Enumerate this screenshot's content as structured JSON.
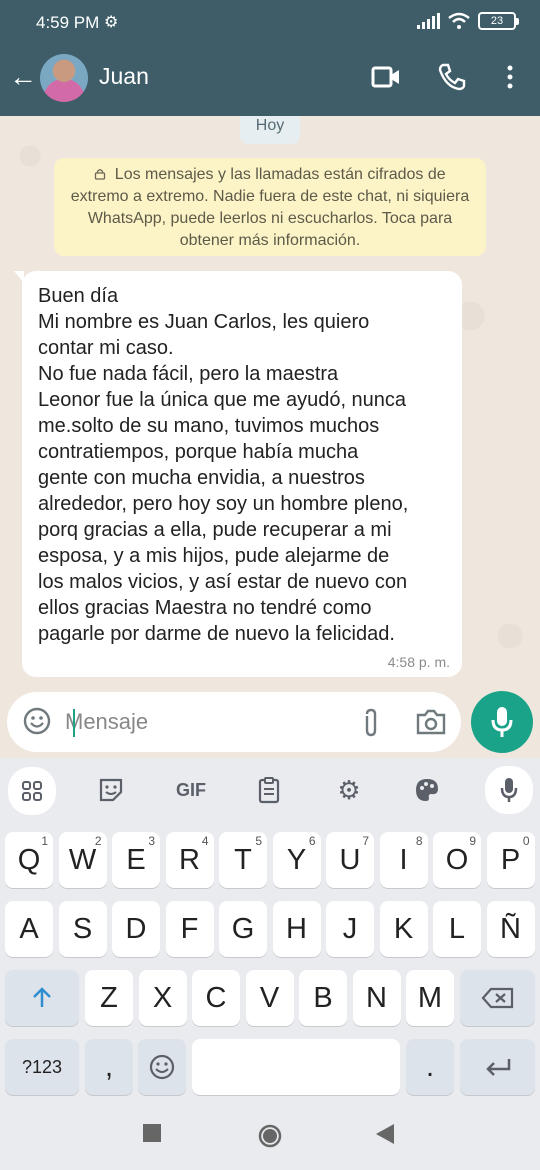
{
  "status": {
    "time": "4:59 PM",
    "battery": "23",
    "icons": [
      "settings-icon",
      "signal-icon",
      "wifi-icon",
      "battery-icon"
    ]
  },
  "header": {
    "title": "Juan",
    "icons": [
      "back-arrow-icon",
      "avatar",
      "video-call-icon",
      "phone-icon",
      "more-icon"
    ]
  },
  "chat": {
    "day_label": "Hoy",
    "encryption_notice": "Los mensajes y las llamadas están cifrados de extremo a extremo. Nadie fuera de este chat, ni siquiera WhatsApp, puede leerlos ni escucharlos. Toca para obtener más información.",
    "message_lines": [
      "Buen día",
      "Mi nombre es Juan Carlos, les quiero",
      "contar mi caso.",
      "No fue nada fácil, pero la maestra",
      "Leonor fue la única que me ayudó, nunca",
      "me.solto de su mano, tuvimos muchos",
      "contratiempos, porque había mucha",
      "gente con mucha envidia, a nuestros",
      "alrededor, pero hoy soy un hombre pleno,",
      "porq gracias a ella, pude recuperar a mi",
      "esposa, y a mis hijos, pude alejarme de",
      "los malos vicios, y así estar de nuevo con",
      "ellos gracias Maestra no tendré como",
      "pagarle por darme de nuevo la felicidad."
    ],
    "message_time": "4:58 p. m."
  },
  "composer": {
    "placeholder": "Mensaje",
    "icons": [
      "emoji-icon",
      "attach-icon",
      "camera-icon",
      "microphone-icon"
    ]
  },
  "keyboard": {
    "toolbar": {
      "gif_label": "GIF"
    },
    "row1": [
      "Q",
      "W",
      "E",
      "R",
      "T",
      "Y",
      "U",
      "I",
      "O",
      "P"
    ],
    "row1_hints": [
      "1",
      "2",
      "3",
      "4",
      "5",
      "6",
      "7",
      "8",
      "9",
      "0"
    ],
    "row2": [
      "A",
      "S",
      "D",
      "F",
      "G",
      "H",
      "J",
      "K",
      "L",
      "Ñ"
    ],
    "row3": [
      "Z",
      "X",
      "C",
      "V",
      "B",
      "N",
      "M"
    ],
    "row4": {
      "symbols": "?123",
      "comma": ",",
      "period": "."
    }
  },
  "colors": {
    "header": "#3e5d68",
    "chat_bg": "#efe7de",
    "accent": "#1aa389",
    "notice_bg": "#fcf4c7"
  }
}
